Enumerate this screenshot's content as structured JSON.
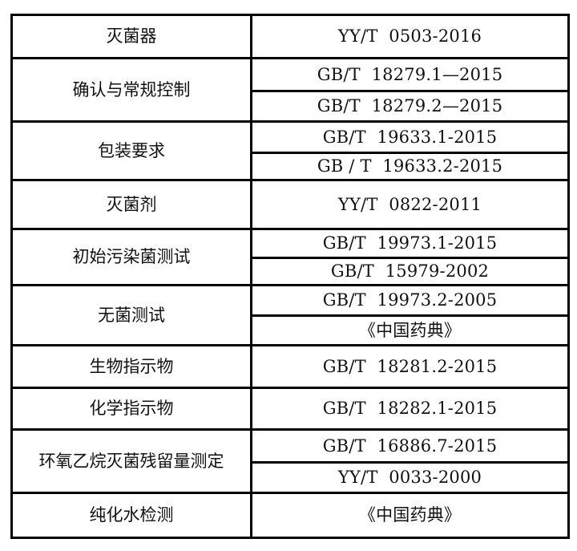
{
  "table": {
    "rows": [
      {
        "category": "灭菌器",
        "standards": [
          "YY/T  0503-2016"
        ]
      },
      {
        "category": "确认与常规控制",
        "standards": [
          "GB/T  18279.1—2015",
          "GB/T  18279.2—2015"
        ]
      },
      {
        "category": "包装要求",
        "standards": [
          "GB/T  19633.1-2015",
          "GB / T  19633.2-2015"
        ]
      },
      {
        "category": "灭菌剂",
        "standards": [
          "YY/T  0822-2011"
        ]
      },
      {
        "category": "初始污染菌测试",
        "standards": [
          "GB/T  19973.1-2015",
          "GB/T  15979-2002"
        ]
      },
      {
        "category": "无菌测试",
        "standards": [
          "GB/T  19973.2-2005",
          "《中国药典》"
        ]
      },
      {
        "category": "生物指示物",
        "standards": [
          "GB/T  18281.2-2015"
        ]
      },
      {
        "category": "化学指示物",
        "standards": [
          "GB/T  18282.1-2015"
        ]
      },
      {
        "category": "环氧乙烷灭菌残留量测定",
        "standards": [
          "GB/T  16886.7-2015",
          "YY/T  0033-2000"
        ]
      },
      {
        "category": "纯化水检测",
        "standards": [
          "《中国药典》"
        ]
      }
    ]
  }
}
